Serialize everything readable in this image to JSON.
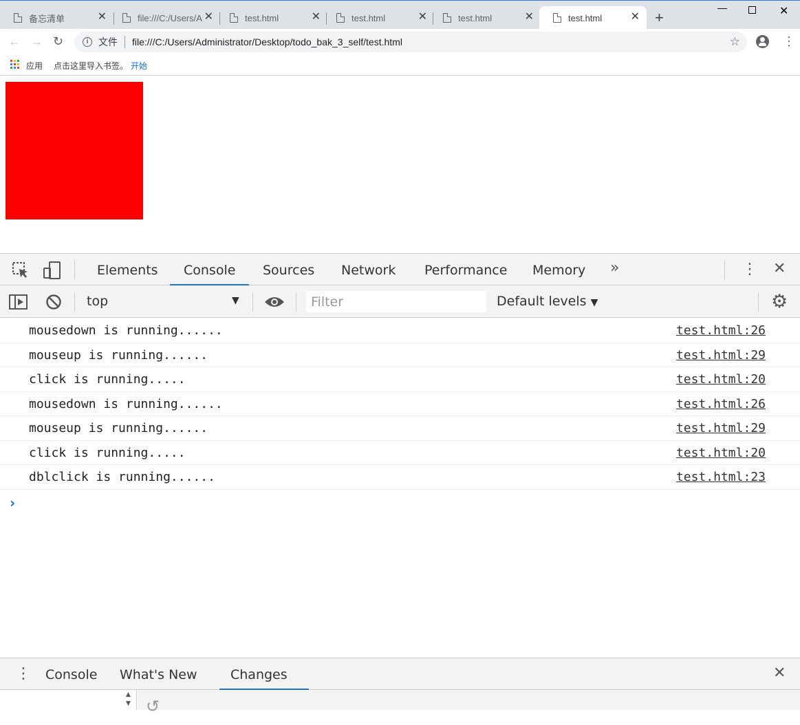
{
  "tabs": [
    {
      "title": "备忘清单",
      "active": false
    },
    {
      "title": "file:///C:/Users/A",
      "active": false
    },
    {
      "title": "test.html",
      "active": false
    },
    {
      "title": "test.html",
      "active": false
    },
    {
      "title": "test.html",
      "active": false
    },
    {
      "title": "test.html",
      "active": true
    }
  ],
  "toolbar": {
    "file_label": "文件",
    "url": "file:///C:/Users/Administrator/Desktop/todo_bak_3_self/test.html"
  },
  "bookmarks": {
    "apps_label": "应用",
    "import_text": "点击这里导入书签。",
    "start_link": "开始"
  },
  "page": {
    "box_color": "#ff0000"
  },
  "devtools": {
    "tabs": [
      "Elements",
      "Console",
      "Sources",
      "Network",
      "Performance",
      "Memory"
    ],
    "active_tab": "Console",
    "context": "top",
    "filter_placeholder": "Filter",
    "levels": "Default levels",
    "messages": [
      {
        "text": "mousedown is running......",
        "source": "test.html:26"
      },
      {
        "text": "mouseup is running......",
        "source": "test.html:29"
      },
      {
        "text": "click is running.....",
        "source": "test.html:20"
      },
      {
        "text": "mousedown is running......",
        "source": "test.html:26"
      },
      {
        "text": "mouseup is running......",
        "source": "test.html:29"
      },
      {
        "text": "click is running.....",
        "source": "test.html:20"
      },
      {
        "text": "dblclick is running......",
        "source": "test.html:23"
      }
    ],
    "drawer_tabs": [
      "Console",
      "What's New",
      "Changes"
    ],
    "drawer_active": "Changes"
  }
}
